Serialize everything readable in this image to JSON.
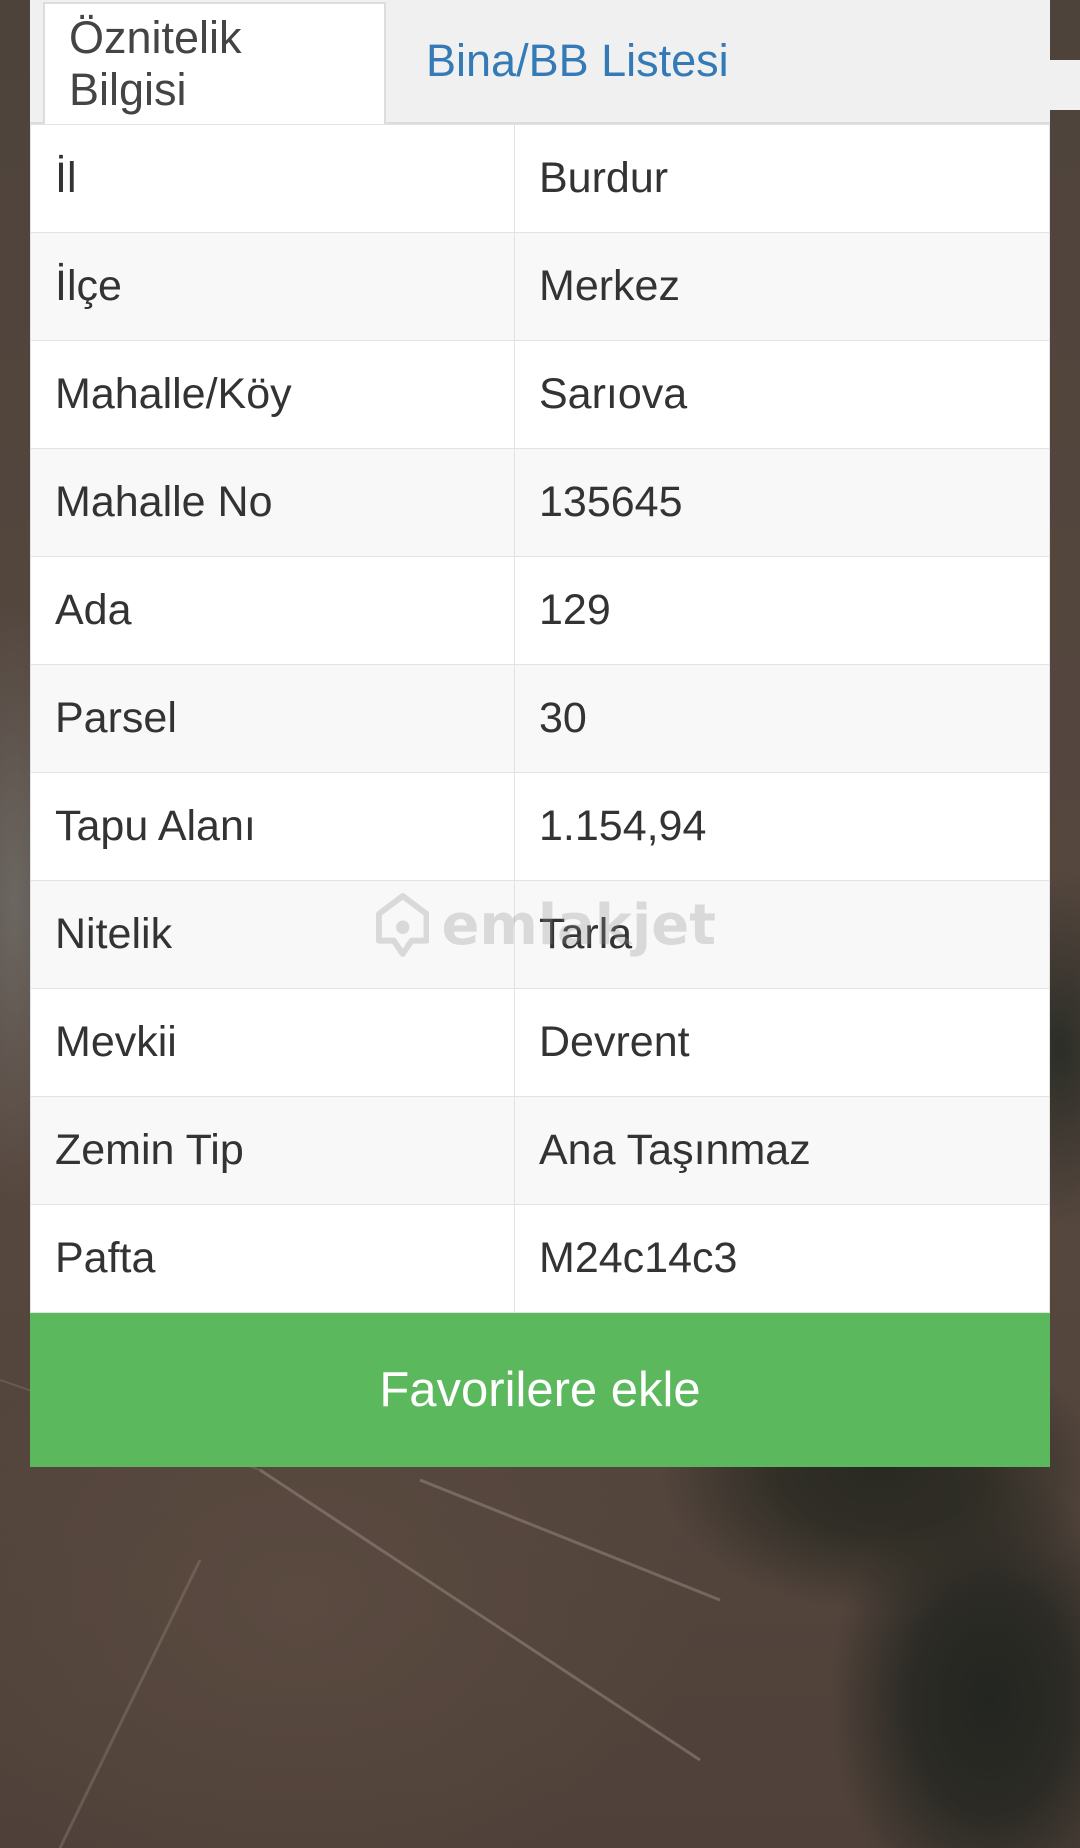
{
  "tabs": [
    {
      "label": "Öznitelik Bilgisi",
      "active": true
    },
    {
      "label": "Bina/BB Listesi",
      "active": false
    }
  ],
  "attributes": [
    {
      "key": "İl",
      "value": "Burdur"
    },
    {
      "key": "İlçe",
      "value": "Merkez"
    },
    {
      "key": "Mahalle/Köy",
      "value": "Sarıova"
    },
    {
      "key": "Mahalle No",
      "value": "135645"
    },
    {
      "key": "Ada",
      "value": "129"
    },
    {
      "key": "Parsel",
      "value": "30"
    },
    {
      "key": "Tapu Alanı",
      "value": "1.154,94"
    },
    {
      "key": "Nitelik",
      "value": "Tarla"
    },
    {
      "key": "Mevkii",
      "value": "Devrent"
    },
    {
      "key": "Zemin Tip",
      "value": "Ana Taşınmaz"
    },
    {
      "key": "Pafta",
      "value": "M24c14c3"
    }
  ],
  "favorite_button": {
    "label": "Favorilere ekle"
  },
  "watermark": {
    "text": "emlakjet",
    "icon": "location-home-icon"
  },
  "colors": {
    "tab_link": "#337ab7",
    "button_green": "#5cb85c",
    "text": "#333333"
  }
}
